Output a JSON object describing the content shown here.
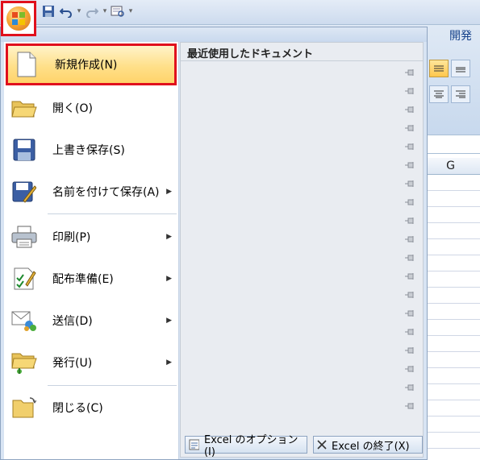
{
  "ribbon": {
    "tab_dev": "開発",
    "column_header": "G"
  },
  "menu": {
    "recent_title": "最近使用したドキュメント",
    "pin_count": 19,
    "items": [
      {
        "label": "新規作成(N)",
        "icon": "new-document-icon",
        "submenu": false
      },
      {
        "label": "開く(O)",
        "icon": "open-folder-icon",
        "submenu": false
      },
      {
        "label": "上書き保存(S)",
        "icon": "save-disk-icon",
        "submenu": false
      },
      {
        "label": "名前を付けて保存(A)",
        "icon": "save-as-icon",
        "submenu": true
      },
      {
        "label": "印刷(P)",
        "icon": "printer-icon",
        "submenu": true
      },
      {
        "label": "配布準備(E)",
        "icon": "prepare-icon",
        "submenu": true
      },
      {
        "label": "送信(D)",
        "icon": "send-icon",
        "submenu": true
      },
      {
        "label": "発行(U)",
        "icon": "publish-icon",
        "submenu": true
      },
      {
        "label": "閉じる(C)",
        "icon": "close-folder-icon",
        "submenu": false
      }
    ],
    "options_button": "Excel のオプション(I)",
    "exit_button": "Excel の終了(X)"
  },
  "colors": {
    "highlight_border": "#e0101d",
    "selected_fill": "#ffe08a"
  }
}
